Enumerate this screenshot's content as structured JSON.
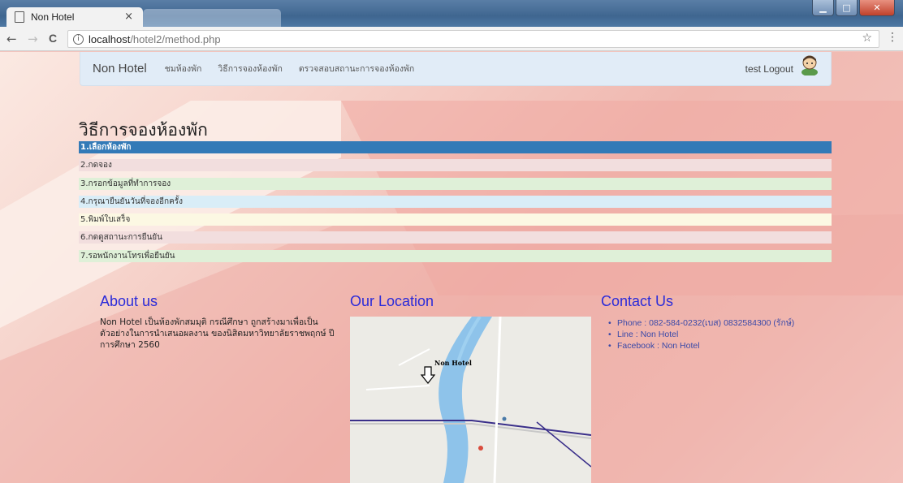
{
  "browser": {
    "tab_title": "Non Hotel",
    "tab_close": "×",
    "url_host": "localhost",
    "url_path": "/hotel2/method.php",
    "back": "←",
    "forward": "→",
    "reload": "C",
    "info": "i",
    "star": "☆",
    "menu": "⋮",
    "minimize": "▁",
    "maximize": "□",
    "close": "✕"
  },
  "navbar": {
    "brand": "Non Hotel",
    "links": [
      "ชมห้องพัก",
      "วิธีการจองห้องพัก",
      "ตรวจสอบสถานะการจองห้องพัก"
    ],
    "logout": "test Logout"
  },
  "heading": "วิธีการจองห้องพัก",
  "steps": [
    {
      "label": "1.เลือกห้องพัก",
      "color": "#337ab7",
      "active": true
    },
    {
      "label": "2.กดจอง",
      "color": "#f2dede"
    },
    {
      "label": "3.กรอกข้อมูลที่ทำการจอง",
      "color": "#dff0d8"
    },
    {
      "label": "4.กรุณายืนยันวันที่จองอีกครั้ง",
      "color": "#d9edf7"
    },
    {
      "label": "5.พิมพ์ใบเสร็จ",
      "color": "#fcf8e3"
    },
    {
      "label": "6.กดดูสถานะการยืนยัน",
      "color": "#f2dede"
    },
    {
      "label": "7.รอพนักงานโทรเพื่อยืนยัน",
      "color": "#dff0d8"
    }
  ],
  "about": {
    "title": "About us",
    "text": "Non Hotel เป็นห้องพักสมมุติ กรณีศึกษา ถูกสร้างมาเพื่อเป็นตัวอย่างในการนำเสนอผลงาน ของนิสิตมหาวิทยาลัยราชพฤกษ์ ปีการศึกษา 2560"
  },
  "location": {
    "title": "Our Location",
    "marker_label": "Non Hotel"
  },
  "contact": {
    "title": "Contact Us",
    "items": [
      "Phone : 082-584-0232(เบส) 0832584300 (รักษ์)",
      "Line : Non Hotel",
      "Facebook : Non Hotel"
    ]
  }
}
